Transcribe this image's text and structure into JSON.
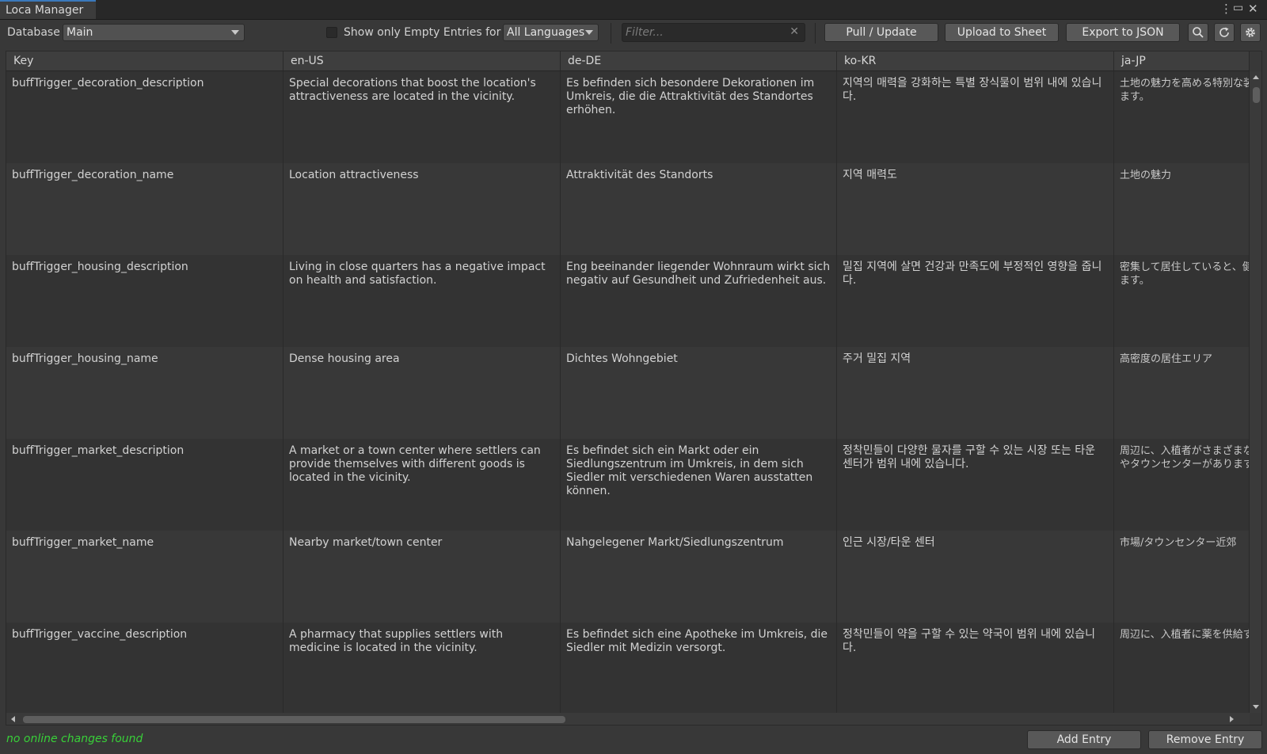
{
  "window": {
    "tab_title": "Loca Manager",
    "menu_icon": "kebab-menu-icon",
    "maximize_icon": "maximize-icon",
    "close_icon": "close-icon"
  },
  "toolbar": {
    "database_label": "Database",
    "database_value": "Main",
    "empty_entries_checked": false,
    "empty_entries_label": "Show only Empty Entries for",
    "language_value": "All Languages",
    "filter_placeholder": "Filter...",
    "filter_value": "",
    "pull_update_label": "Pull / Update",
    "upload_sheet_label": "Upload to Sheet",
    "export_json_label": "Export to JSON",
    "search_icon": "search-icon",
    "refresh_icon": "refresh-icon",
    "settings_icon": "gear-icon"
  },
  "table": {
    "columns": [
      "Key",
      "en-US",
      "de-DE",
      "ko-KR",
      "ja-JP"
    ],
    "rows": [
      {
        "key": "buffTrigger_decoration_description",
        "en": "Special decorations that boost the location's attractiveness are located in the vicinity.",
        "de": "Es befinden sich besondere Dekorationen im Umkreis, die die Attraktivität des Standortes erhöhen.",
        "ko": "지역의 매력을 강화하는 특별 장식물이 범위 내에 있습니다.",
        "ja": "土地の魅力を高める特別な装\nます。"
      },
      {
        "key": "buffTrigger_decoration_name",
        "en": "Location attractiveness",
        "de": "Attraktivität des Standorts",
        "ko": "지역 매력도",
        "ja": "土地の魅力"
      },
      {
        "key": "buffTrigger_housing_description",
        "en": "Living in close quarters has a negative impact on health and satisfaction.",
        "de": "Eng beeinander liegender Wohnraum wirkt sich negativ auf Gesundheit und Zufriedenheit aus.",
        "ko": "밀집 지역에 살면 건강과 만족도에 부정적인 영향을 줍니다.",
        "ja": "密集して居住していると、健康\nます。"
      },
      {
        "key": "buffTrigger_housing_name",
        "en": "Dense housing area",
        "de": "Dichtes Wohngebiet",
        "ko": "주거 밀집 지역",
        "ja": "高密度の居住エリア"
      },
      {
        "key": "buffTrigger_market_description",
        "en": "A market or a town center where settlers can provide themselves with different goods is located in the vicinity.",
        "de": "Es befindet sich ein Markt oder ein Siedlungszentrum im Umkreis, in dem sich Siedler mit verschiedenen Waren ausstatten können.",
        "ko": "정착민들이 다양한 물자를 구할 수 있는 시장 또는 타운 센터가 범위 내에 있습니다.",
        "ja": "周辺に、入植者がさまざまな物\nやタウンセンターがあります。"
      },
      {
        "key": "buffTrigger_market_name",
        "en": "Nearby market/town center",
        "de": "Nahgelegener Markt/Siedlungszentrum",
        "ko": "인근 시장/타운 센터",
        "ja": "市場/タウンセンター近郊"
      },
      {
        "key": "buffTrigger_vaccine_description",
        "en": "A pharmacy that supplies settlers with medicine is located in the vicinity.",
        "de": "Es befindet sich eine Apotheke im Umkreis, die Siedler mit Medizin versorgt.",
        "ko": "정착민들이 약을 구할 수 있는 약국이 범위 내에 있습니다.",
        "ja": "周辺に、入植者に薬を供給す"
      }
    ]
  },
  "footer": {
    "status_text": "no online changes found",
    "add_entry_label": "Add Entry",
    "remove_entry_label": "Remove Entry"
  },
  "colors": {
    "accent_tab": "#3a79bb",
    "status_ok": "#38d038",
    "panel_bg": "#383838"
  }
}
